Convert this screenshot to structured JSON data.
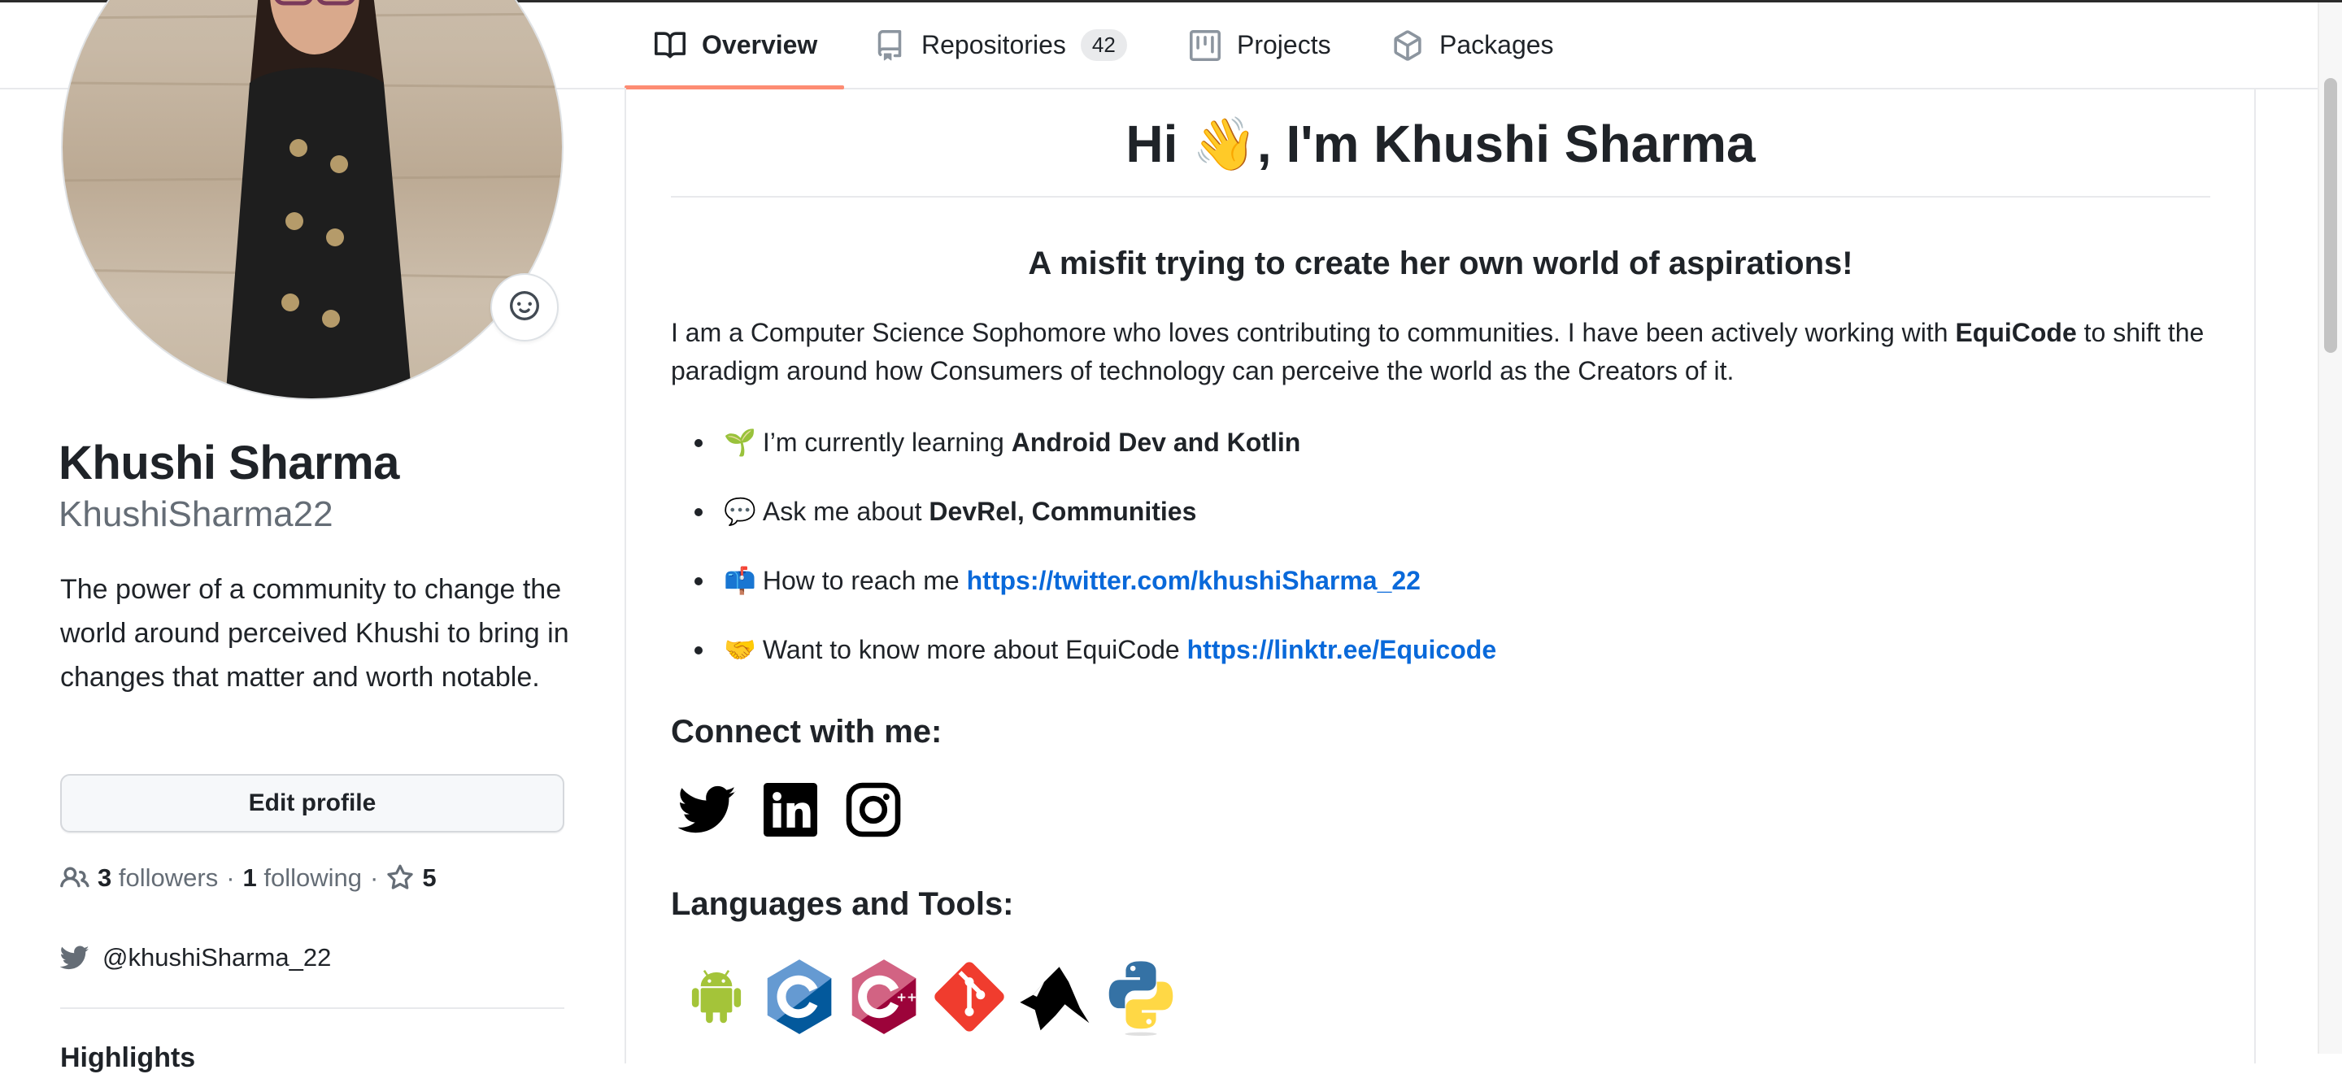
{
  "tabs": [
    {
      "label": "Overview",
      "icon": "book-icon",
      "active": true
    },
    {
      "label": "Repositories",
      "icon": "repo-icon",
      "count": "42"
    },
    {
      "label": "Projects",
      "icon": "project-icon"
    },
    {
      "label": "Packages",
      "icon": "package-icon"
    }
  ],
  "profile": {
    "name": "Khushi Sharma",
    "login": "KhushiSharma22",
    "bio": "The power of a community to change the world around perceived Khushi to bring in changes that matter and worth notable.",
    "edit_label": "Edit profile",
    "followers_count": "3",
    "followers_label": "followers",
    "following_count": "1",
    "following_label": "following",
    "stars_count": "5",
    "twitter": "@khushiSharma_22",
    "highlights_heading": "Highlights"
  },
  "readme": {
    "title_before": "Hi ",
    "title_emoji": "👋",
    "title_after": ", I'm Khushi Sharma",
    "subtitle": "A misfit trying to create her own world of aspirations!",
    "intro_part1": "I am a Computer Science Sophomore who loves contributing to communities. I have been actively working with ",
    "intro_bold": "EquiCode",
    "intro_part2": " to shift the paradigm around how Consumers of technology can perceive the world as the Creators of it.",
    "bullets": [
      {
        "emoji": "🌱",
        "text": "I’m currently learning ",
        "bold": "Android Dev and Kotlin"
      },
      {
        "emoji": "💬",
        "text": "Ask me about ",
        "bold": "DevRel, Communities"
      },
      {
        "emoji": "📫",
        "text": "How to reach me ",
        "link": "https://twitter.com/khushiSharma_22"
      },
      {
        "emoji": "🤝",
        "text": "Want to know more about EquiCode ",
        "link": "https://linktr.ee/Equicode"
      }
    ],
    "connect_heading": "Connect with me:",
    "socials": [
      "twitter",
      "linkedin",
      "instagram"
    ],
    "langs_heading": "Languages and Tools:",
    "langs": [
      "android",
      "c",
      "cplusplus",
      "git",
      "matlab",
      "python"
    ]
  },
  "colors": {
    "accent_underline": "#fd8c73",
    "link": "#0969da",
    "text": "#1f2328",
    "muted": "#656d76"
  }
}
